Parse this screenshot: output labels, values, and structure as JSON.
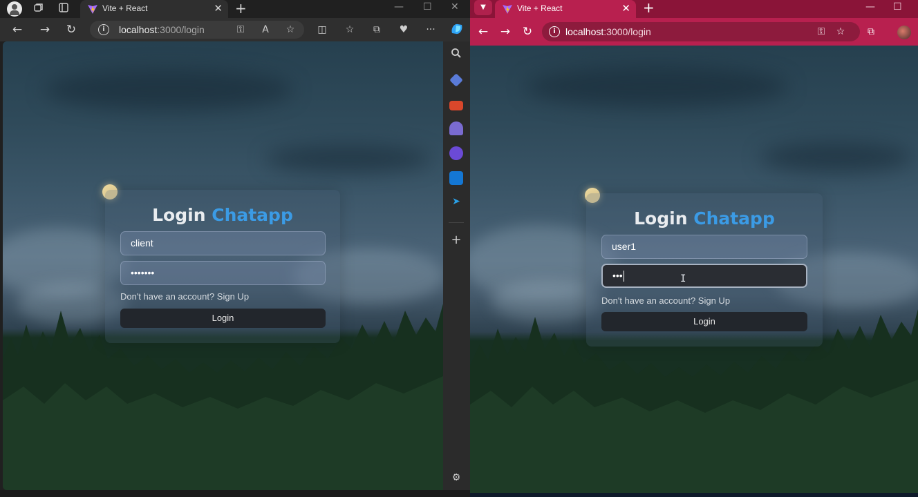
{
  "left_browser": {
    "tab_title": "Vite + React",
    "url_host": "localhost",
    "url_rest": ":3000/login",
    "login": {
      "title": "Login",
      "title_accent": "Chatapp",
      "username_value": "client",
      "password_value": "•••••••",
      "signup_text": "Don't have an account? Sign Up",
      "button_label": "Login"
    }
  },
  "right_browser": {
    "tab_title": "Vite + React",
    "url_host": "localhost",
    "url_rest": ":3000/login",
    "login": {
      "title": "Login",
      "title_accent": "Chatapp",
      "username_value": "user1",
      "password_value": "•••",
      "signup_text": "Don't have an account? Sign Up",
      "button_label": "Login"
    }
  },
  "icons": {
    "close": "✕",
    "new_tab": "+",
    "back": "←",
    "forward": "→",
    "reload": "↻",
    "text_cursor": "I"
  },
  "colors": {
    "accent": "#3b9be5",
    "chrome_theme": "#b8204f"
  }
}
